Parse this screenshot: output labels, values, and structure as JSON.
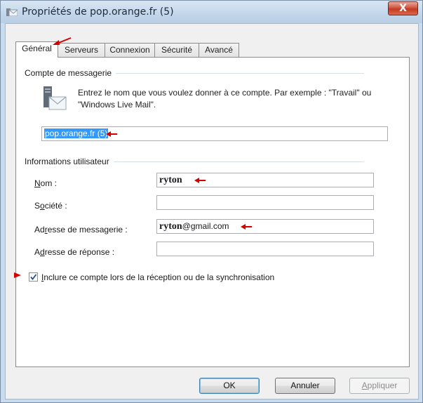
{
  "window": {
    "title": "Propriétés de pop.orange.fr (5)",
    "close_label": "X"
  },
  "tabs": [
    {
      "label": "Général",
      "selected": true
    },
    {
      "label": "Serveurs"
    },
    {
      "label": "Connexion"
    },
    {
      "label": "Sécurité"
    },
    {
      "label": "Avancé"
    }
  ],
  "account": {
    "section_title": "Compte de messagerie",
    "description": "Entrez le nom que vous voulez donner à ce compte. Par exemple : \"Travail\" ou \"Windows Live Mail\".",
    "name_value": "pop.orange.fr (5)"
  },
  "user": {
    "section_title": "Informations utilisateur",
    "name_label_prefix": "",
    "name_label_u": "N",
    "name_label_rest": "om :",
    "name_value": "ryton",
    "company_label_prefix": "S",
    "company_label_u": "o",
    "company_label_rest": "ciété :",
    "company_value": "",
    "email_label_prefix": "Ad",
    "email_label_u": "r",
    "email_label_rest": "esse de messagerie :",
    "email_value_bold": "ryton",
    "email_value_rest": "@gmail.com",
    "reply_label_prefix": "A",
    "reply_label_u": "d",
    "reply_label_rest": "resse de réponse :",
    "reply_value": ""
  },
  "include_checkbox": {
    "checked": true,
    "label_u": "I",
    "label_rest": "nclure ce compte lors de la réception ou de la synchronisation"
  },
  "buttons": {
    "ok": "OK",
    "cancel": "Annuler",
    "apply_u": "A",
    "apply_rest": "ppliquer"
  },
  "colors": {
    "annotation_arrow": "#d40000",
    "selection": "#3399ff"
  }
}
